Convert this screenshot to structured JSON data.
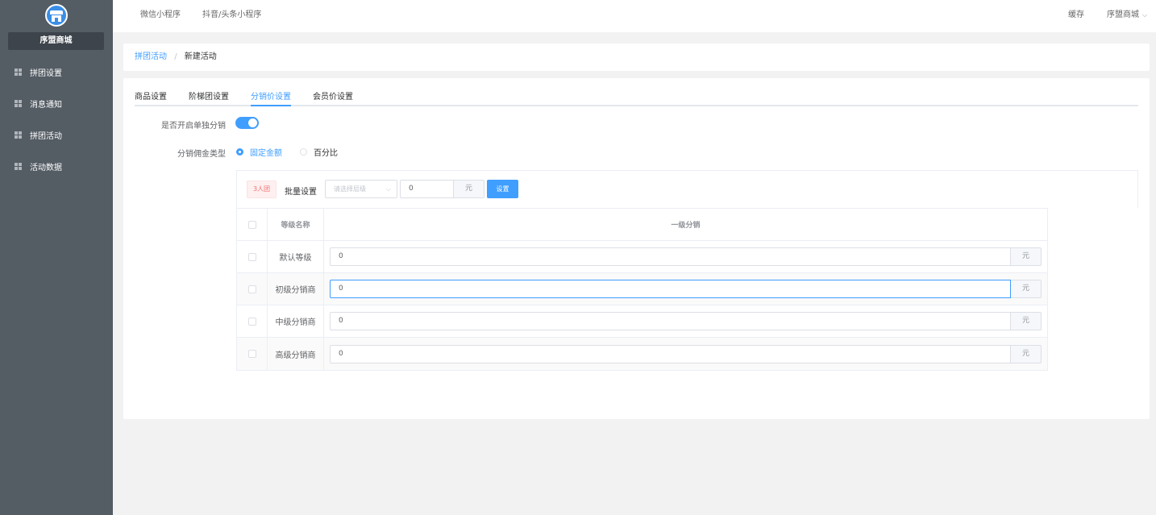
{
  "sidebar": {
    "shop_name": "序盟商城",
    "items": [
      {
        "label": "拼团设置",
        "icon": "grid-icon"
      },
      {
        "label": "消息通知",
        "icon": "grid-icon"
      },
      {
        "label": "拼团活动",
        "icon": "grid-icon"
      },
      {
        "label": "活动数据",
        "icon": "grid-icon"
      }
    ]
  },
  "topbar": {
    "nav": [
      "微信小程序",
      "抖音/头条小程序"
    ],
    "cache_label": "缓存",
    "shop_dropdown": "序盟商城"
  },
  "breadcrumb": {
    "parent": "拼团活动",
    "separator": "/",
    "current": "新建活动"
  },
  "tabs": [
    {
      "label": "商品设置",
      "active": false
    },
    {
      "label": "阶梯团设置",
      "active": false
    },
    {
      "label": "分销价设置",
      "active": true
    },
    {
      "label": "会员价设置",
      "active": false
    }
  ],
  "form": {
    "single_distribution_label": "是否开启单独分销",
    "single_distribution_on": true,
    "commission_type_label": "分销佣金类型",
    "commission_options": [
      {
        "label": "固定金额",
        "checked": true
      },
      {
        "label": "百分比",
        "checked": false
      }
    ]
  },
  "batch": {
    "tag": "3人团",
    "label": "批量设置",
    "select_placeholder": "请选择层级",
    "value": "0",
    "unit": "元",
    "button": "设置"
  },
  "table": {
    "headers": {
      "name": "等级名称",
      "level1": "一级分销"
    },
    "unit": "元",
    "rows": [
      {
        "name": "默认等级",
        "value": "0"
      },
      {
        "name": "初级分销商",
        "value": "0"
      },
      {
        "name": "中级分销商",
        "value": "0"
      },
      {
        "name": "高级分销商",
        "value": "0"
      }
    ]
  },
  "colors": {
    "sidebar_bg": "#545c64",
    "accent": "#409eff",
    "tag_red": "#f56c6c"
  }
}
